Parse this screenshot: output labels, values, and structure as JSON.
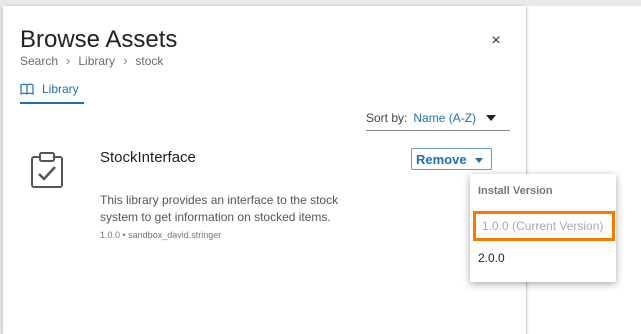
{
  "header": {
    "title": "Browse Assets",
    "close_symbol": "×"
  },
  "breadcrumb": [
    "Search",
    "Library",
    "stock"
  ],
  "breadcrumb_separator": "›",
  "tab": {
    "label": "Library",
    "icon": "book-icon"
  },
  "sort": {
    "label": "Sort by:",
    "value": "Name (A-Z)"
  },
  "asset": {
    "icon": "clipboard-check-icon",
    "name": "StockInterface",
    "description": "This library provides an interface to the stock system to get information on stocked items.",
    "meta": "1.0.0 • sandbox_david.stringer",
    "action_label": "Remove"
  },
  "version_menu": {
    "header": "Install Version",
    "items": [
      {
        "label": "1.0.0 (Current Version)",
        "disabled": true,
        "highlighted": true
      },
      {
        "label": "2.0.0",
        "disabled": false
      }
    ]
  },
  "colors": {
    "accent": "#1e6fb1",
    "highlight_border": "#f57c00"
  }
}
